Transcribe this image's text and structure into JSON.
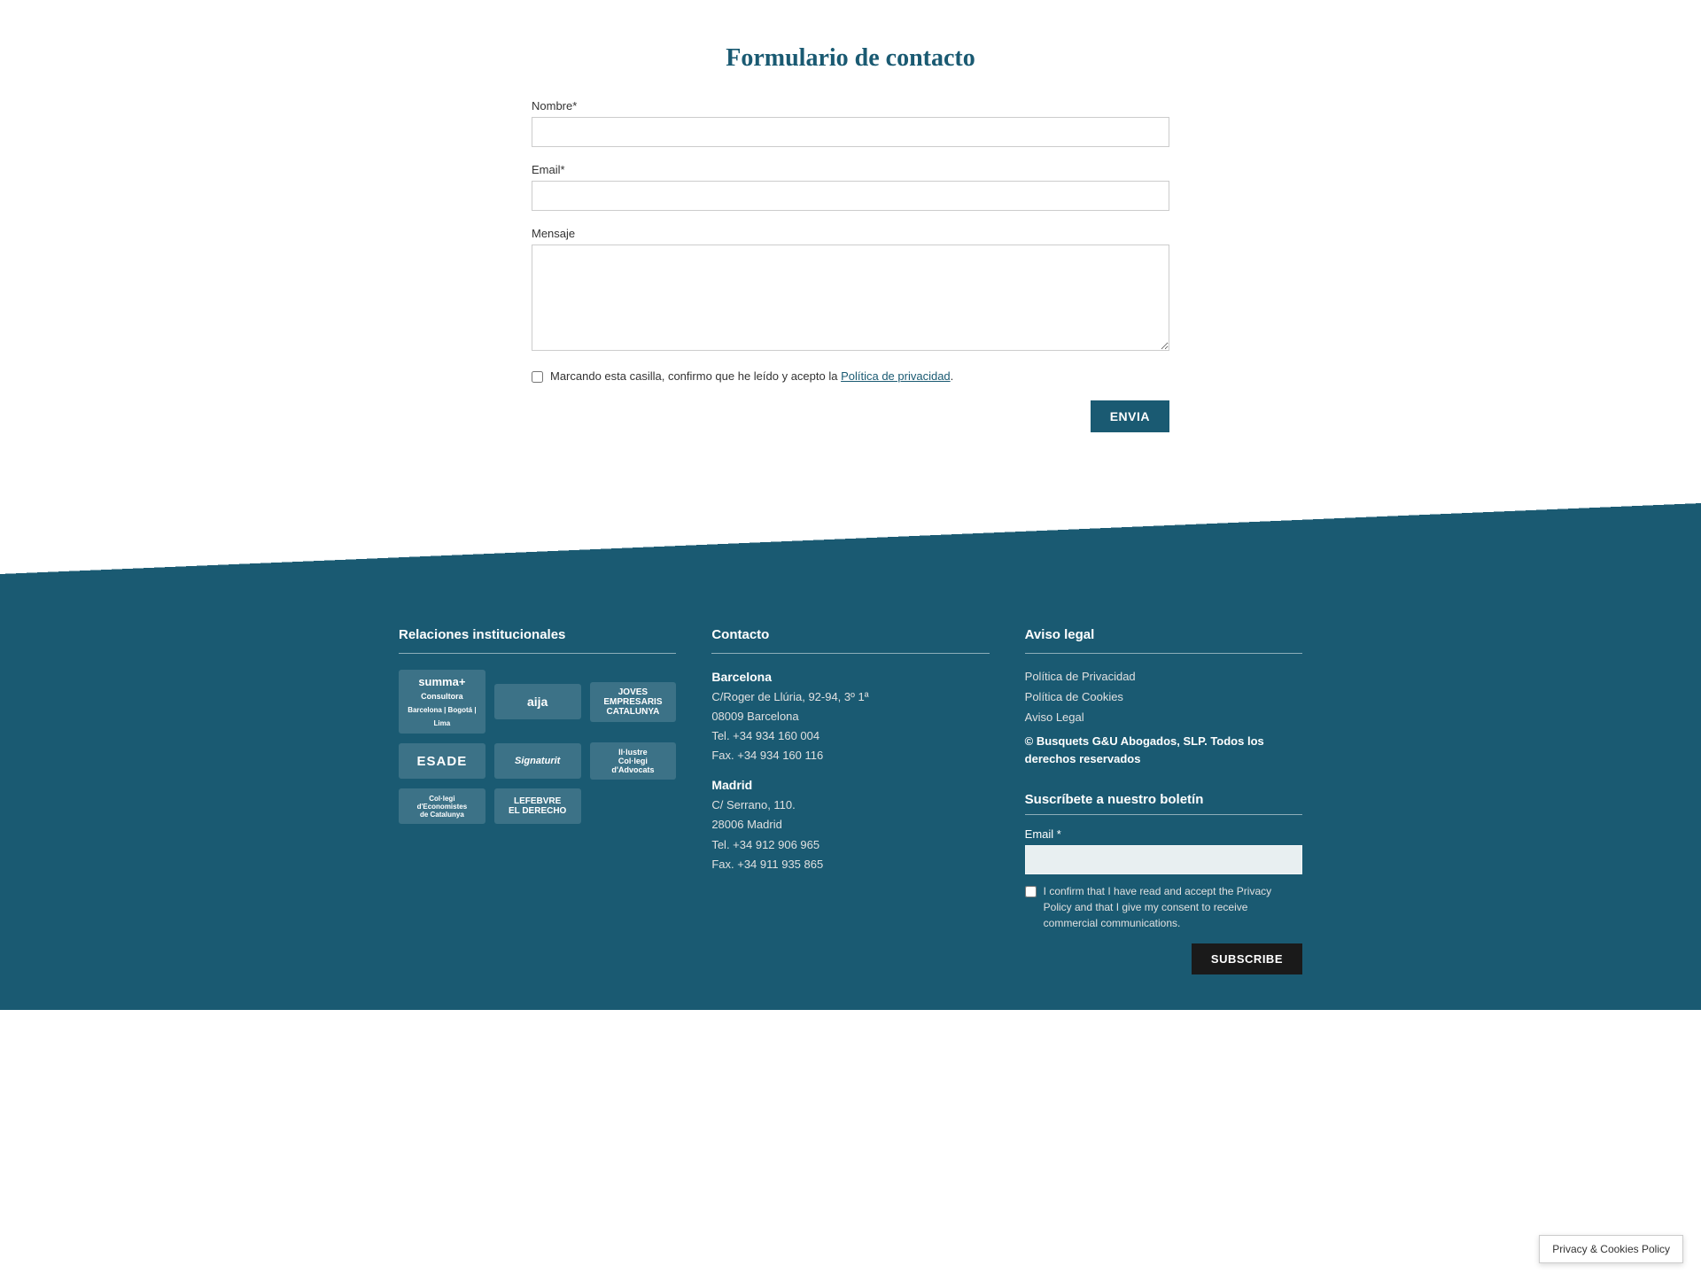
{
  "form": {
    "title": "Formulario de contacto",
    "nombre_label": "Nombre*",
    "email_label": "Email*",
    "mensaje_label": "Mensaje",
    "privacy_text_before": "Marcando esta casilla, confirmo que he leído y acepto la ",
    "privacy_link_text": "Política de privacidad",
    "privacy_text_after": ".",
    "submit_label": "ENVIA"
  },
  "footer": {
    "relaciones_title": "Relaciones institucionales",
    "logos": [
      {
        "text": "summa+ Consultora",
        "sub": "Barcelona | Bogotá | Lima"
      },
      {
        "text": "aija"
      },
      {
        "text": "JOVES EMPRESARIS CATALUNYA"
      },
      {
        "text": "ESADE"
      },
      {
        "text": "Signaturit"
      },
      {
        "text": "Il·lustre Col·legi d'Advocats"
      },
      {
        "text": "Col·legi d'Economistes de Catalunya"
      },
      {
        "text": "LEFEBVRE EL DERECHO"
      }
    ],
    "contacto_title": "Contacto",
    "barcelona": {
      "city": "Barcelona",
      "address": "C/Roger de Llúria, 92-94, 3º 1ª",
      "postal": "08009 Barcelona",
      "tel": "Tel. +34 934 160 004",
      "fax": "Fax. +34 934 160 116"
    },
    "madrid": {
      "city": "Madrid",
      "address": "C/ Serrano, 110.",
      "postal": "28006 Madrid",
      "tel": "Tel. +34 912 906 965",
      "fax": "Fax. +34 911 935 865"
    },
    "aviso_title": "Aviso legal",
    "privacidad_link": "Política de Privacidad",
    "cookies_link": "Política de Cookies",
    "aviso_link": "Aviso Legal",
    "copyright": "© Busquets G&U Abogados, SLP. Todos los derechos reservados",
    "newsletter_title": "Suscríbete a nuestro boletín",
    "email_label": "Email *",
    "consent_text": "I confirm that I have read and accept the Privacy Policy and that I give my consent to receive commercial communications.",
    "subscribe_label": "SUBSCRIBE"
  },
  "privacy_cookies_btn": "Privacy & Cookies Policy"
}
